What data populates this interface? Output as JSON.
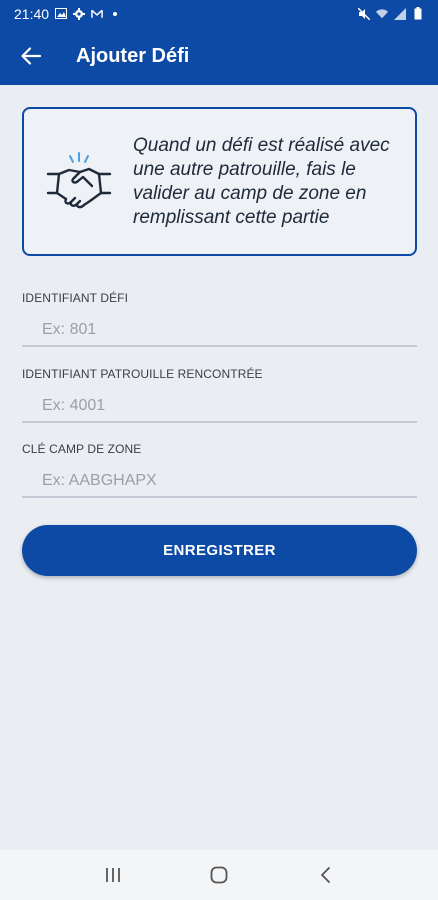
{
  "status_bar": {
    "time": "21:40",
    "left_icons": [
      "image-icon",
      "settings-icon",
      "mail-icon",
      "dot-icon"
    ],
    "right_icons": [
      "mute-icon",
      "wifi-icon",
      "signal-icon",
      "battery-icon"
    ]
  },
  "app_bar": {
    "title": "Ajouter Défi",
    "background": "#0d4aa6"
  },
  "info_card": {
    "icon": "handshake-icon",
    "text": "Quand un défi est réalisé avec une autre patrouille, fais le valider au camp de zone en remplissant cette partie"
  },
  "form": {
    "fields": [
      {
        "label": "IDENTIFIANT DÉFI",
        "placeholder": "Ex: 801",
        "value": ""
      },
      {
        "label": "IDENTIFIANT PATROUILLE RENCONTRÉE",
        "placeholder": "Ex: 4001",
        "value": ""
      },
      {
        "label": "CLÉ CAMP DE ZONE",
        "placeholder": "Ex: AABGHAPX",
        "value": ""
      }
    ],
    "submit_label": "ENREGISTRER"
  },
  "colors": {
    "primary": "#0d4aa6",
    "page_background": "#eaeef3",
    "icon_accent": "#4aa3df"
  }
}
